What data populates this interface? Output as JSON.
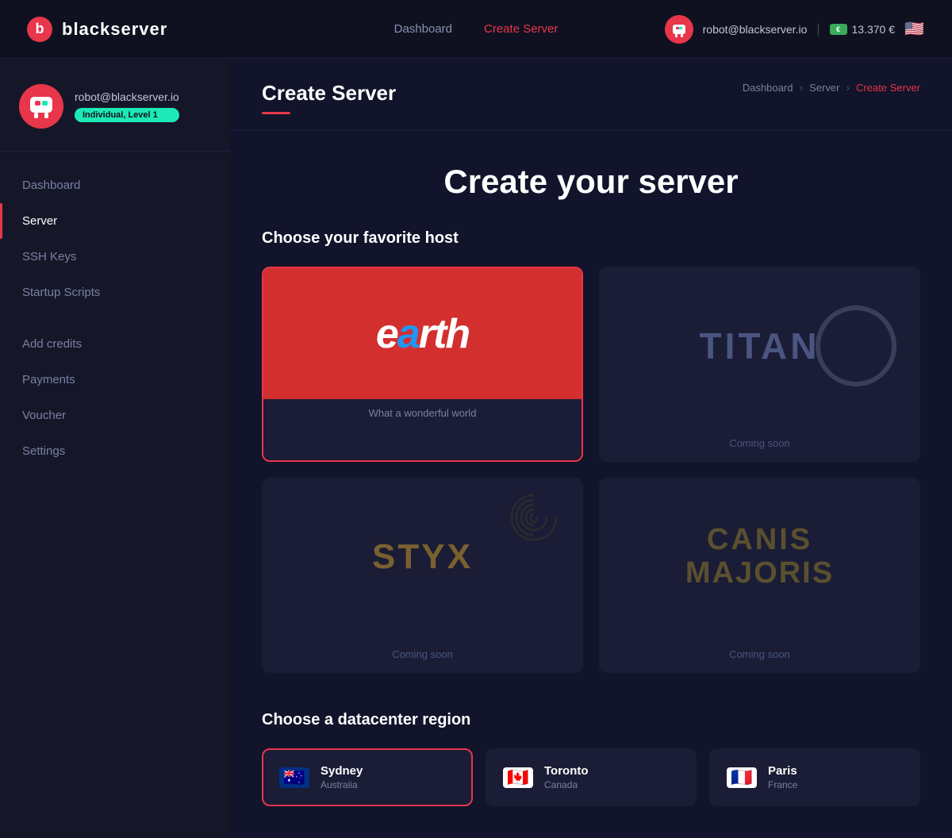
{
  "topnav": {
    "logo_text": "blackserver",
    "links": [
      {
        "label": "Dashboard",
        "active": false
      },
      {
        "label": "Create Server",
        "active": true
      }
    ],
    "email": "robot@blackserver.io",
    "credits": "13.370 €"
  },
  "sidebar": {
    "username": "robot@blackserver.io",
    "badge": "Individual, Level 1",
    "nav_items": [
      {
        "label": "Dashboard",
        "active": false
      },
      {
        "label": "Server",
        "active": true
      },
      {
        "label": "SSH Keys",
        "active": false
      },
      {
        "label": "Startup Scripts",
        "active": false
      },
      {
        "label": "Add credits",
        "active": false
      },
      {
        "label": "Payments",
        "active": false
      },
      {
        "label": "Voucher",
        "active": false
      },
      {
        "label": "Settings",
        "active": false
      }
    ]
  },
  "breadcrumb": {
    "items": [
      {
        "label": "Dashboard",
        "active": false
      },
      {
        "label": "Server",
        "active": false
      },
      {
        "label": "Create Server",
        "active": true
      }
    ]
  },
  "page": {
    "title": "Create Server",
    "hero_title": "Create your server"
  },
  "host_section": {
    "heading": "Choose your favorite host",
    "hosts": [
      {
        "id": "earth",
        "name": "earth",
        "tagline": "What a wonderful world",
        "selected": true,
        "coming_soon": false
      },
      {
        "id": "titan",
        "name": "TITAN",
        "selected": false,
        "coming_soon": true,
        "coming_soon_label": "Coming soon"
      },
      {
        "id": "styx",
        "name": "STYX",
        "selected": false,
        "coming_soon": true,
        "coming_soon_label": "Coming soon"
      },
      {
        "id": "canis",
        "name": "CANIS MAJORIS",
        "selected": false,
        "coming_soon": true,
        "coming_soon_label": "Coming soon"
      }
    ]
  },
  "region_section": {
    "heading": "Choose a datacenter region",
    "regions": [
      {
        "city": "Sydney",
        "country": "Australia",
        "flag": "au",
        "selected": true
      },
      {
        "city": "Toronto",
        "country": "Canada",
        "flag": "ca",
        "selected": false
      },
      {
        "city": "Paris",
        "country": "France",
        "flag": "fr",
        "selected": false
      }
    ]
  }
}
